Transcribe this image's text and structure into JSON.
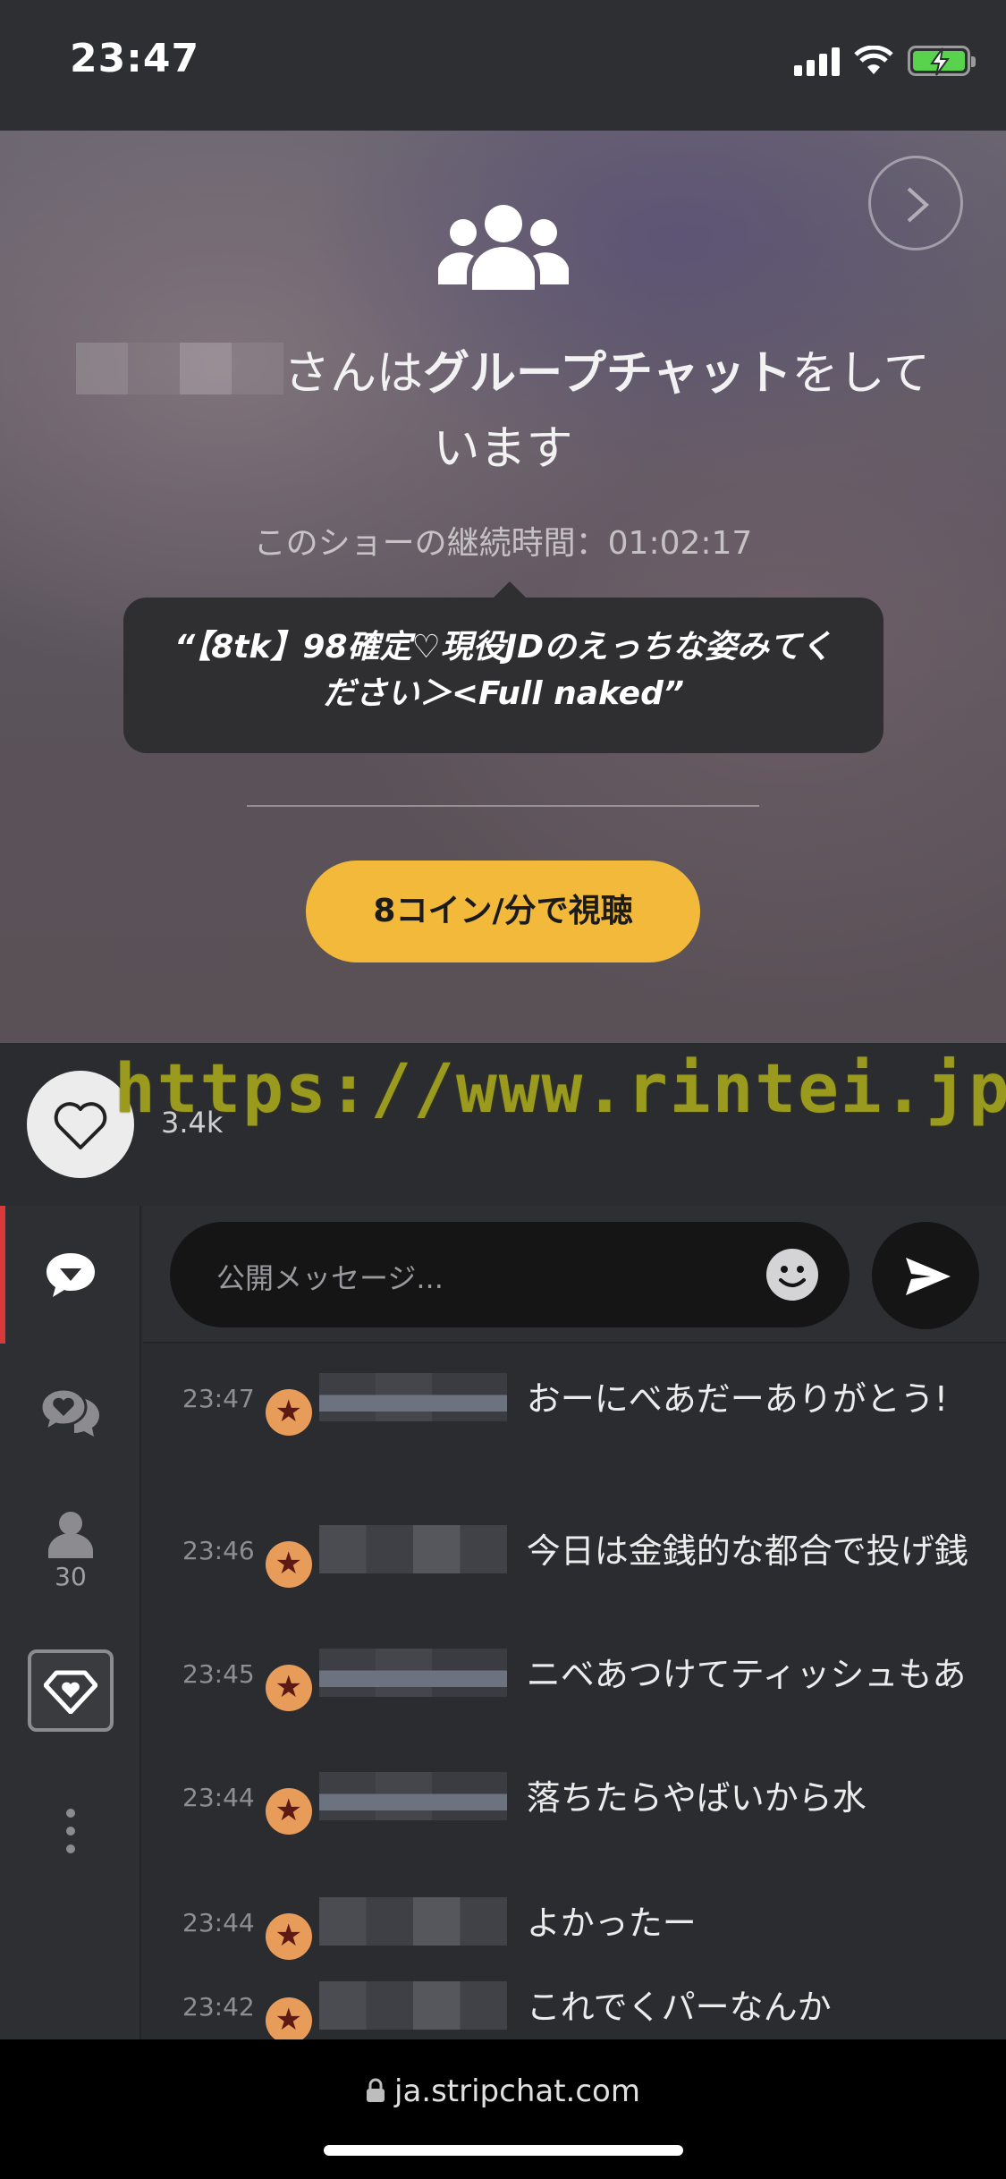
{
  "status_bar": {
    "time": "23:47"
  },
  "show": {
    "headline_suffix_1": "さんは",
    "headline_bold": "グループチャット",
    "headline_suffix_2": "をしています",
    "duration_label": "このショーの継続時間：01:02:17",
    "topic": "“【8tk】98確定♡現役JDのえっちな姿みてください＞<Full naked”",
    "watch_button": "8コイン/分で視聴"
  },
  "like": {
    "count": "3.4k"
  },
  "watermark": "https://www.rintei.jp/",
  "sidebar": {
    "users_count": "30"
  },
  "chat": {
    "input_placeholder": "公開メッセージ...",
    "messages": [
      {
        "time": "23:47",
        "text": "おーにべあだーありがとう!"
      },
      {
        "time": "23:46",
        "text": "今日は金銭的な都合で投げ銭"
      },
      {
        "time": "23:45",
        "text": "ニベあつけてティッシュもあ"
      },
      {
        "time": "23:44",
        "text": "落ちたらやばいから水"
      },
      {
        "time": "23:44",
        "text": "よかったー"
      },
      {
        "time": "23:42",
        "text": "これでくパーなんか"
      }
    ]
  },
  "url_bar": {
    "domain": "ja.stripchat.com"
  },
  "colors": {
    "accent_yellow": "#f2b93a",
    "active_tab": "#d83a3a",
    "star_badge": "#e79c5a"
  }
}
